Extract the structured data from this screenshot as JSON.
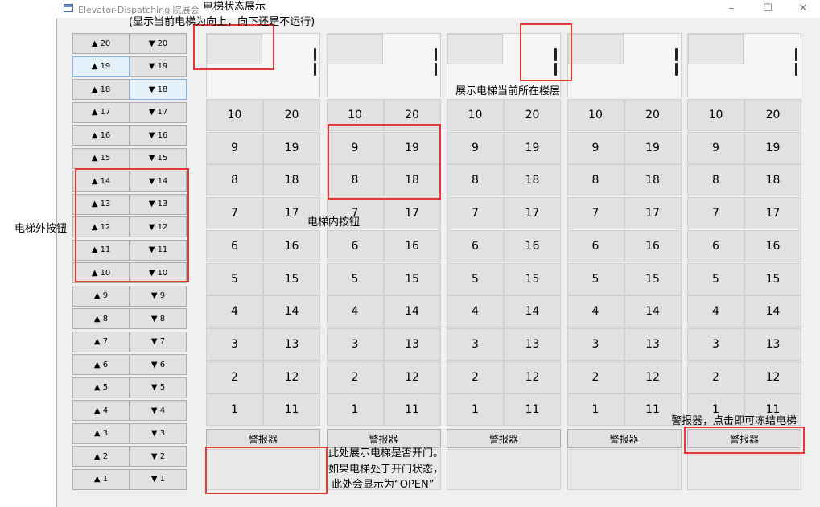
{
  "window": {
    "title": "Elevator-Dispatching 院展会"
  },
  "outside_buttons": [
    {
      "floor": 20,
      "up": "▲ 20",
      "down": "▼ 20"
    },
    {
      "floor": 19,
      "up": "▲ 19",
      "down": "▼ 19"
    },
    {
      "floor": 18,
      "up": "▲ 18",
      "down": "▼ 18"
    },
    {
      "floor": 17,
      "up": "▲ 17",
      "down": "▼ 17"
    },
    {
      "floor": 16,
      "up": "▲ 16",
      "down": "▼ 16"
    },
    {
      "floor": 15,
      "up": "▲ 15",
      "down": "▼ 15"
    },
    {
      "floor": 14,
      "up": "▲ 14",
      "down": "▼ 14"
    },
    {
      "floor": 13,
      "up": "▲ 13",
      "down": "▼ 13"
    },
    {
      "floor": 12,
      "up": "▲ 12",
      "down": "▼ 12"
    },
    {
      "floor": 11,
      "up": "▲ 11",
      "down": "▼ 11"
    },
    {
      "floor": 10,
      "up": "▲ 10",
      "down": "▼ 10"
    },
    {
      "floor": 9,
      "up": "▲ 9",
      "down": "▼ 9"
    },
    {
      "floor": 8,
      "up": "▲ 8",
      "down": "▼ 8"
    },
    {
      "floor": 7,
      "up": "▲ 7",
      "down": "▼ 7"
    },
    {
      "floor": 6,
      "up": "▲ 6",
      "down": "▼ 6"
    },
    {
      "floor": 5,
      "up": "▲ 5",
      "down": "▼ 5"
    },
    {
      "floor": 4,
      "up": "▲ 4",
      "down": "▼ 4"
    },
    {
      "floor": 3,
      "up": "▲ 3",
      "down": "▼ 3"
    },
    {
      "floor": 2,
      "up": "▲ 2",
      "down": "▼ 2"
    },
    {
      "floor": 1,
      "up": "▲ 1",
      "down": "▼ 1"
    }
  ],
  "elevators": [
    {
      "floor_display": "1",
      "alarm_label": "警报器",
      "door_text": ""
    },
    {
      "floor_display": "1",
      "alarm_label": "警报器",
      "door_text": ""
    },
    {
      "floor_display": "1",
      "alarm_label": "警报器",
      "door_text": ""
    },
    {
      "floor_display": "1",
      "alarm_label": "警报器",
      "door_text": ""
    },
    {
      "floor_display": "1",
      "alarm_label": "警报器",
      "door_text": ""
    }
  ],
  "inside_floor_rows": [
    [
      "10",
      "20"
    ],
    [
      "9",
      "19"
    ],
    [
      "8",
      "18"
    ],
    [
      "7",
      "17"
    ],
    [
      "6",
      "16"
    ],
    [
      "5",
      "15"
    ],
    [
      "4",
      "14"
    ],
    [
      "3",
      "13"
    ],
    [
      "2",
      "12"
    ],
    [
      "1",
      "11"
    ]
  ],
  "annotations": {
    "status_title": "电梯状态展示",
    "status_sub": "(显示当前电梯为向上，向下还是不运行)",
    "current_floor": "展示电梯当前所在楼层",
    "inside_buttons": "电梯内按钮",
    "outside_buttons": "电梯外按钮",
    "door_line1": "此处展示电梯是否开门。",
    "door_line2": "如果电梯处于开门状态，",
    "door_line3": "此处会显示为“OPEN”",
    "alarm": "警报器，点击即可冻结电梯"
  },
  "highlight": {
    "hovered_outside": [
      "up-19",
      "down-18"
    ],
    "annotation_color": "#e53935"
  }
}
